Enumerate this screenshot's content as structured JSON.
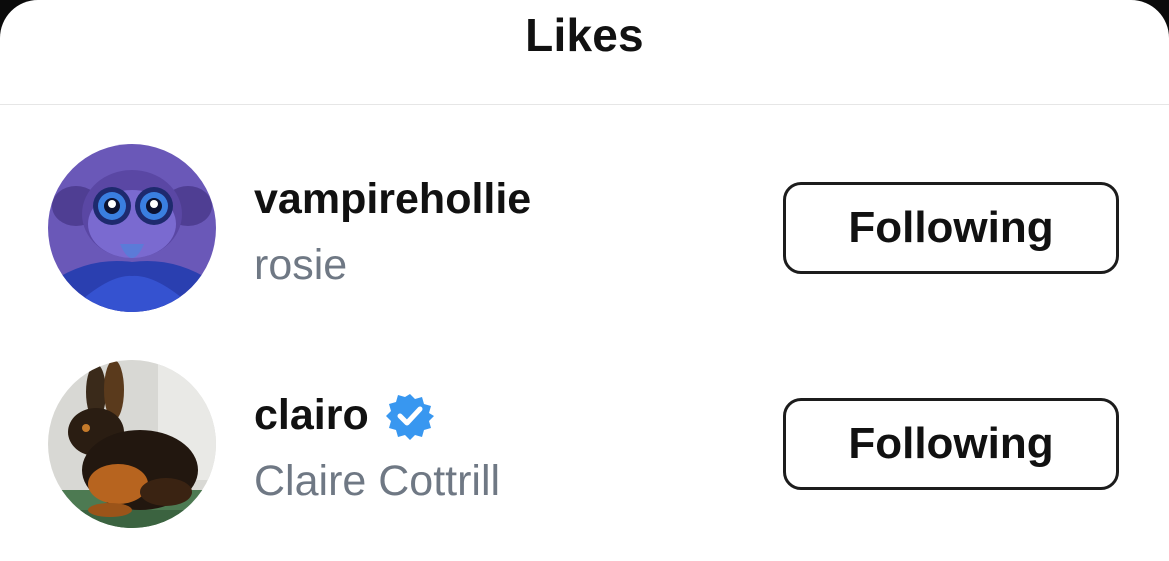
{
  "header": {
    "title": "Likes"
  },
  "likes": [
    {
      "username": "vampirehollie",
      "full_name": "rosie",
      "verified": false,
      "button_label": "Following",
      "avatar": "cartoon-girl-avatar"
    },
    {
      "username": "clairo",
      "full_name": "Claire Cottrill",
      "verified": true,
      "button_label": "Following",
      "avatar": "rabbit-photo-avatar"
    }
  ],
  "colors": {
    "background": "#ffffff",
    "secondary_text": "#6f7884",
    "verified_badge": "#3897f0",
    "button_border": "#1c1c1c"
  }
}
